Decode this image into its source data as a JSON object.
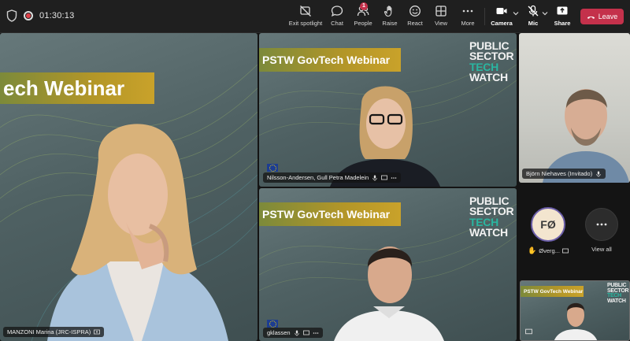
{
  "meeting": {
    "timer": "01:30:13"
  },
  "toolbar": {
    "exit_spotlight": "Exit spotlight",
    "chat": "Chat",
    "people": "People",
    "people_badge": "1",
    "raise": "Raise",
    "react": "React",
    "view": "View",
    "more": "More",
    "camera": "Camera",
    "mic": "Mic",
    "share": "Share",
    "leave": "Leave",
    "leave_color": "#c4314b"
  },
  "slide": {
    "banner_main": "ech Webinar",
    "banner_small": "PSTW GovTech Webinar",
    "logo_line1": "PUBLIC",
    "logo_line2": "SECTOR",
    "logo_line3": "TECH",
    "logo_line4": "WATCH"
  },
  "participants": {
    "spotlight_name": "MANZONI Marina (JRC-ISPRA)",
    "top_middle_name": "Nilsson-Andersen, Gull Petra Madelein",
    "bottom_middle_name": "gklassen",
    "top_right_name": "Björn Niehaves (Invitado)",
    "avatar_initials": "FØ",
    "avatar_name": "Øverg...",
    "view_all": "View all"
  },
  "colors": {
    "background": "#141414",
    "toolbar": "#1f1f1f",
    "accent_teal": "#2ab5a0",
    "banner_gold": "#c9a22a",
    "avatar_ring": "#6b5ea9"
  }
}
